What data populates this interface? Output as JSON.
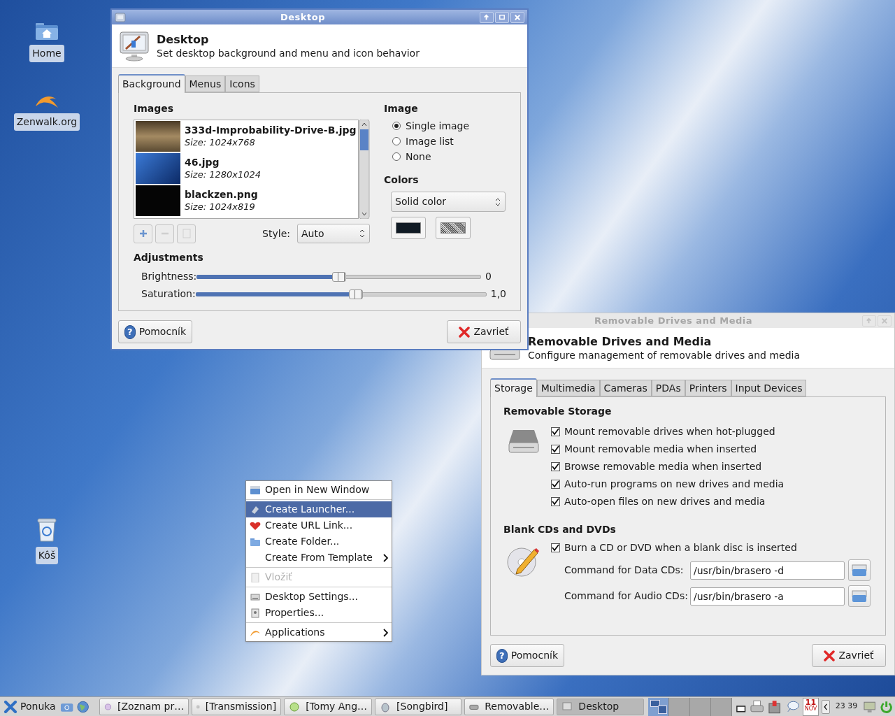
{
  "desktop_icons": [
    {
      "label": "Home"
    },
    {
      "label": "Zenwalk.org"
    },
    {
      "label": "Kôš"
    }
  ],
  "desktop_window": {
    "title": "Desktop",
    "heading": "Desktop",
    "subtitle": "Set desktop background and menu and icon behavior",
    "tabs": [
      {
        "label": "Background",
        "selected": true
      },
      {
        "label": "Menus",
        "selected": false
      },
      {
        "label": "Icons",
        "selected": false
      }
    ],
    "images_heading": "Images",
    "images": [
      {
        "name": "333d-Improbability-Drive-B.jpg",
        "size": "Size: 1024x768"
      },
      {
        "name": "46.jpg",
        "size": "Size: 1280x1024"
      },
      {
        "name": "blackzen.png",
        "size": "Size: 1024x819"
      }
    ],
    "style_label": "Style:",
    "style_value": "Auto",
    "image_heading": "Image",
    "image_options": [
      {
        "label": "Single image",
        "selected": true
      },
      {
        "label": "Image list",
        "selected": false
      },
      {
        "label": "None",
        "selected": false
      }
    ],
    "colors_heading": "Colors",
    "colors_value": "Solid color",
    "adjustments_heading": "Adjustments",
    "sliders": [
      {
        "label": "Brightness:",
        "level": 0.5,
        "reading": "0"
      },
      {
        "label": "Saturation:",
        "level": 0.55,
        "reading": "1,0"
      }
    ],
    "buttons": [
      {
        "kind": "help",
        "icon_glyph": "?",
        "label": "Pomocník"
      },
      {
        "kind": "close",
        "label": "Zavrieť"
      }
    ]
  },
  "removable_window": {
    "title": "Removable Drives and Media",
    "heading": "Removable Drives and Media",
    "subtitle": "Configure management of removable drives and media",
    "tabs": [
      {
        "label": "Storage",
        "selected": true
      },
      {
        "label": "Multimedia",
        "selected": false
      },
      {
        "label": "Cameras",
        "selected": false
      },
      {
        "label": "PDAs",
        "selected": false
      },
      {
        "label": "Printers",
        "selected": false
      },
      {
        "label": "Input Devices",
        "selected": false
      }
    ],
    "storage_heading": "Removable Storage",
    "storage_options": [
      {
        "label": "Mount removable drives when hot-plugged",
        "checked": true
      },
      {
        "label": "Mount removable media when inserted",
        "checked": true
      },
      {
        "label": "Browse removable media when inserted",
        "checked": true
      },
      {
        "label": "Auto-run programs on new drives and media",
        "checked": true
      },
      {
        "label": "Auto-open files on new drives and media",
        "checked": true
      }
    ],
    "blank_heading": "Blank CDs and DVDs",
    "burn_option": {
      "label": "Burn a CD or DVD when a blank disc is inserted",
      "checked": true
    },
    "commands": [
      {
        "label": "Command for Data CDs:",
        "value": "/usr/bin/brasero -d"
      },
      {
        "label": "Command for Audio CDs:",
        "value": "/usr/bin/brasero -a"
      }
    ],
    "buttons": [
      {
        "kind": "help",
        "icon_glyph": "?",
        "label": "Pomocník"
      },
      {
        "kind": "close",
        "label": "Zavrieť"
      }
    ]
  },
  "context_menu": [
    {
      "kind": "item",
      "label": "Open in New Window",
      "selected": false,
      "disabled": false,
      "submenu": false
    },
    {
      "kind": "separator"
    },
    {
      "kind": "item",
      "label": "Create Launcher...",
      "selected": true,
      "disabled": false,
      "submenu": false
    },
    {
      "kind": "item",
      "label": "Create URL Link...",
      "selected": false,
      "disabled": false,
      "submenu": false
    },
    {
      "kind": "item",
      "label": "Create Folder...",
      "selected": false,
      "disabled": false,
      "submenu": false
    },
    {
      "kind": "item",
      "label": "Create From Template",
      "selected": false,
      "disabled": false,
      "submenu": true
    },
    {
      "kind": "separator"
    },
    {
      "kind": "item",
      "label": "Vložiť",
      "selected": false,
      "disabled": true,
      "submenu": false
    },
    {
      "kind": "separator"
    },
    {
      "kind": "item",
      "label": "Desktop Settings...",
      "selected": false,
      "disabled": false,
      "submenu": false
    },
    {
      "kind": "item",
      "label": "Properties...",
      "selected": false,
      "disabled": false,
      "submenu": false
    },
    {
      "kind": "separator"
    },
    {
      "kind": "item",
      "label": "Applications",
      "selected": false,
      "disabled": false,
      "submenu": true
    }
  ],
  "taskbar": {
    "menu_label": "Ponuka",
    "tasks": [
      {
        "label": "[Zoznam pr…",
        "selected": false
      },
      {
        "label": "[Transmission]",
        "selected": false
      },
      {
        "label": "[Tomy Ang…",
        "selected": false
      },
      {
        "label": "[Songbird]",
        "selected": false
      },
      {
        "label": "Removable…",
        "selected": false
      },
      {
        "label": "Desktop",
        "selected": true
      }
    ],
    "workspaces": [
      {
        "selected": true
      },
      {
        "selected": false
      },
      {
        "selected": false
      },
      {
        "selected": false
      }
    ],
    "calendar_day": "11",
    "calendar_month": "NOV",
    "clock": "23 39"
  }
}
